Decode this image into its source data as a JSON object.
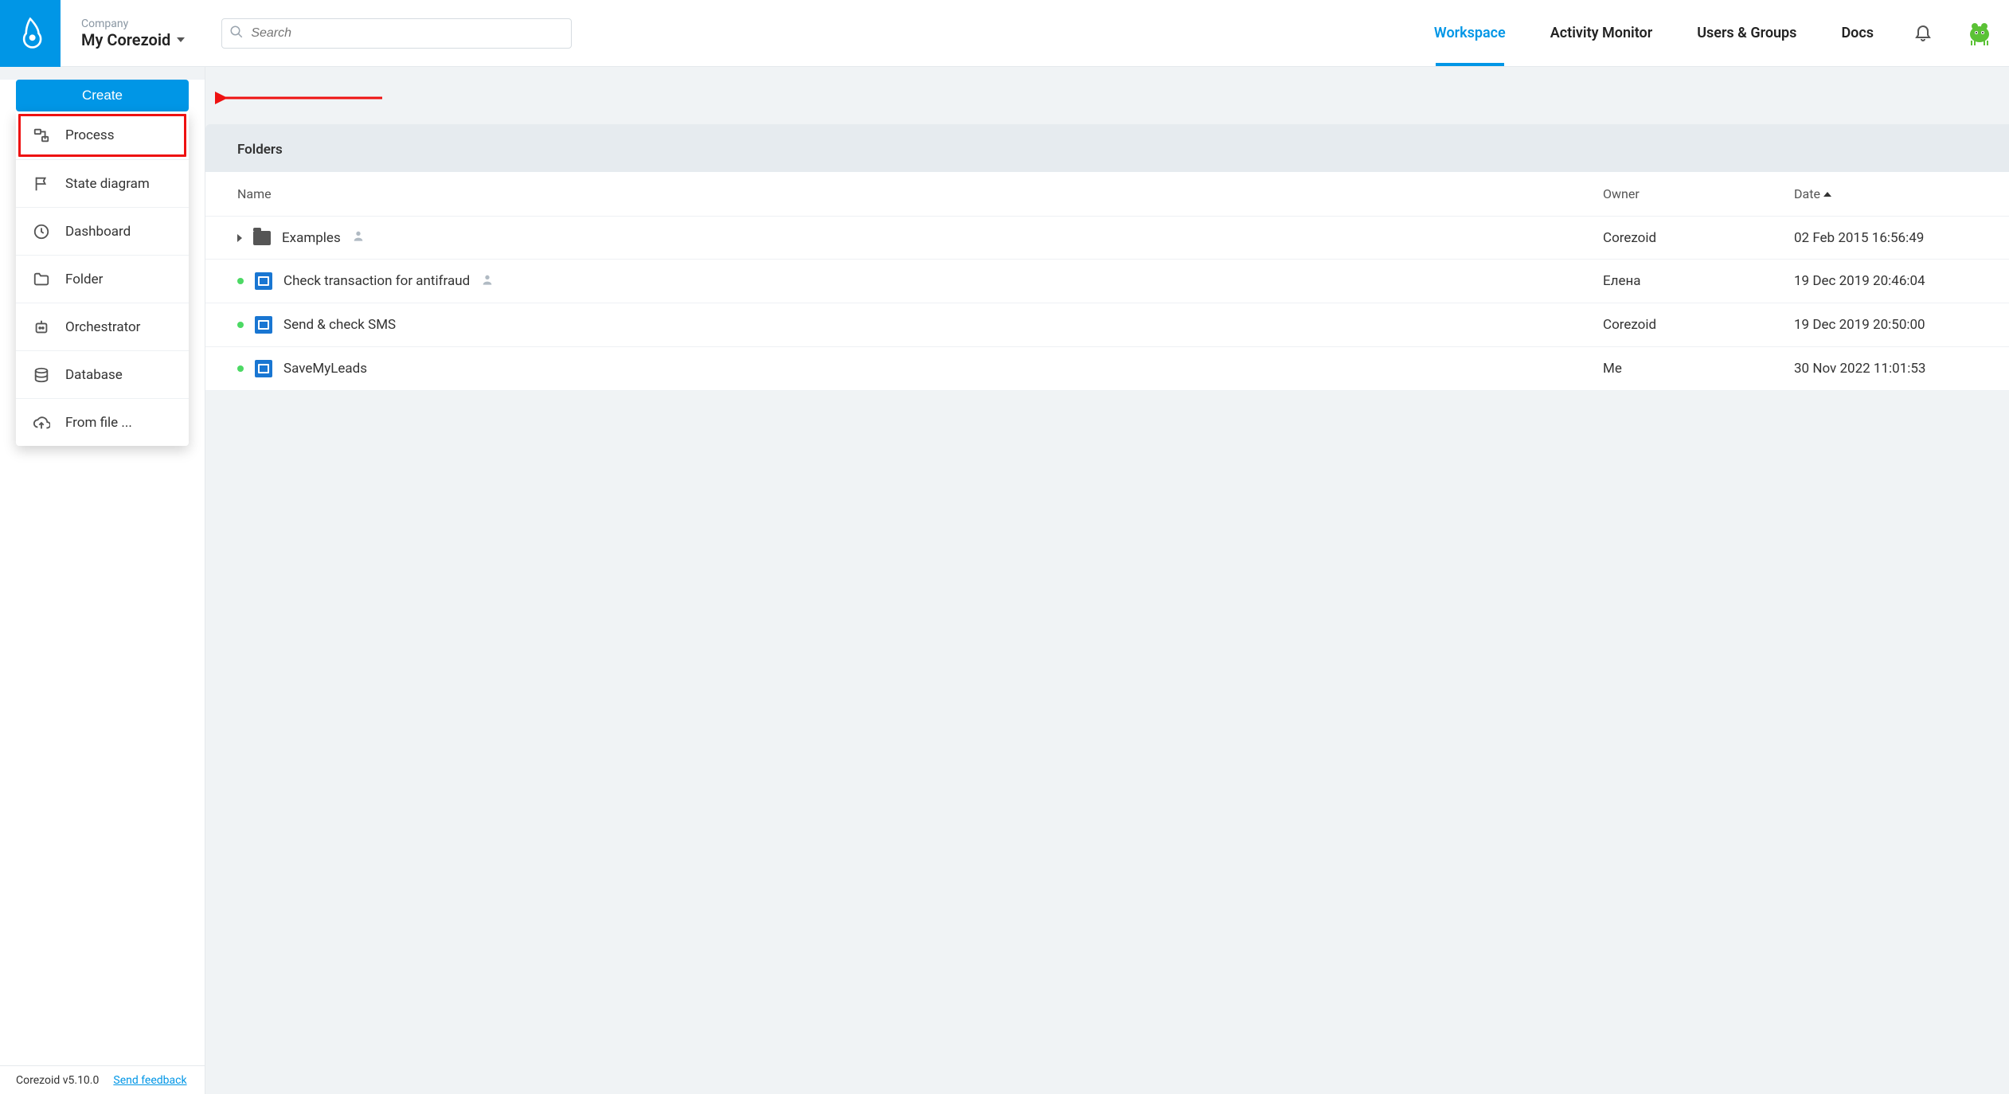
{
  "header": {
    "company_label": "Company",
    "company_name": "My Corezoid",
    "search_placeholder": "Search",
    "nav": {
      "workspace": "Workspace",
      "activity": "Activity Monitor",
      "users": "Users & Groups",
      "docs": "Docs"
    }
  },
  "sidebar": {
    "create_label": "Create",
    "items": [
      {
        "label": "Process"
      },
      {
        "label": "State diagram"
      },
      {
        "label": "Dashboard"
      },
      {
        "label": "Folder"
      },
      {
        "label": "Orchestrator"
      },
      {
        "label": "Database"
      },
      {
        "label": "From file ..."
      }
    ]
  },
  "content": {
    "title": "Folders",
    "columns": {
      "name": "Name",
      "owner": "Owner",
      "date": "Date"
    },
    "rows": [
      {
        "name": "Examples",
        "owner": "Corezoid",
        "date": "02 Feb 2015 16:56:49"
      },
      {
        "name": "Check transaction for antifraud",
        "owner": "Елена",
        "date": "19 Dec 2019 20:46:04"
      },
      {
        "name": "Send & check SMS",
        "owner": "Corezoid",
        "date": "19 Dec 2019 20:50:00"
      },
      {
        "name": "SaveMyLeads",
        "owner": "Me",
        "date": "30 Nov 2022 11:01:53"
      }
    ]
  },
  "footer": {
    "version": "Corezoid v5.10.0",
    "feedback": "Send feedback"
  }
}
